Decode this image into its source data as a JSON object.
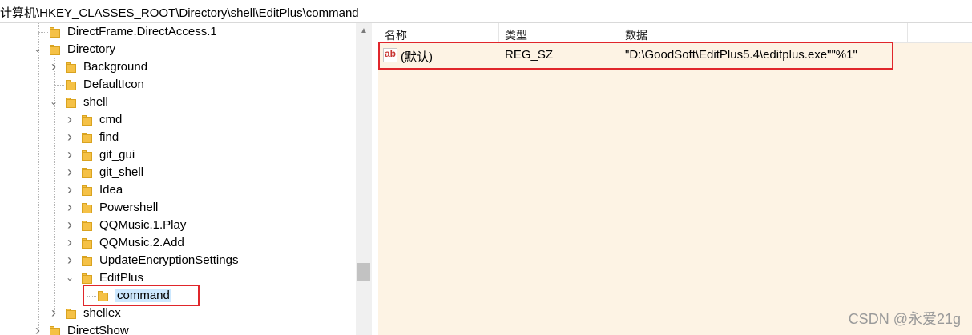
{
  "address": {
    "path": "计算机\\HKEY_CLASSES_ROOT\\Directory\\shell\\EditPlus\\command"
  },
  "tree": {
    "items": [
      {
        "label": "DirectFrame.DirectAccess.1",
        "level": 1,
        "expand": "none"
      },
      {
        "label": "Directory",
        "level": 1,
        "expand": "expanded"
      },
      {
        "label": "Background",
        "level": 2,
        "expand": "collapsed"
      },
      {
        "label": "DefaultIcon",
        "level": 2,
        "expand": "none"
      },
      {
        "label": "shell",
        "level": 2,
        "expand": "expanded"
      },
      {
        "label": "cmd",
        "level": 3,
        "expand": "collapsed"
      },
      {
        "label": "find",
        "level": 3,
        "expand": "collapsed"
      },
      {
        "label": "git_gui",
        "level": 3,
        "expand": "collapsed"
      },
      {
        "label": "git_shell",
        "level": 3,
        "expand": "collapsed"
      },
      {
        "label": "Idea",
        "level": 3,
        "expand": "collapsed"
      },
      {
        "label": "Powershell",
        "level": 3,
        "expand": "collapsed"
      },
      {
        "label": "QQMusic.1.Play",
        "level": 3,
        "expand": "collapsed"
      },
      {
        "label": "QQMusic.2.Add",
        "level": 3,
        "expand": "collapsed"
      },
      {
        "label": "UpdateEncryptionSettings",
        "level": 3,
        "expand": "collapsed"
      },
      {
        "label": "EditPlus",
        "level": 3,
        "expand": "expanded"
      },
      {
        "label": "command",
        "level": 4,
        "expand": "none",
        "selected": true
      },
      {
        "label": "shellex",
        "level": 2,
        "expand": "collapsed"
      },
      {
        "label": "DirectShow",
        "level": 1,
        "expand": "collapsed"
      }
    ]
  },
  "list": {
    "columns": [
      "名称",
      "类型",
      "数据"
    ],
    "rows": [
      {
        "icon": "ab",
        "name": "(默认)",
        "type": "REG_SZ",
        "data": "\"D:\\GoodSoft\\EditPlus5.4\\editplus.exe\"\"%1\""
      }
    ]
  },
  "watermark": "CSDN @永爱21g",
  "colors": {
    "highlight_border": "#e0262b",
    "selected_bg": "#cce8ff",
    "list_bg": "#fdf3e4",
    "folder": "#f5c146"
  }
}
